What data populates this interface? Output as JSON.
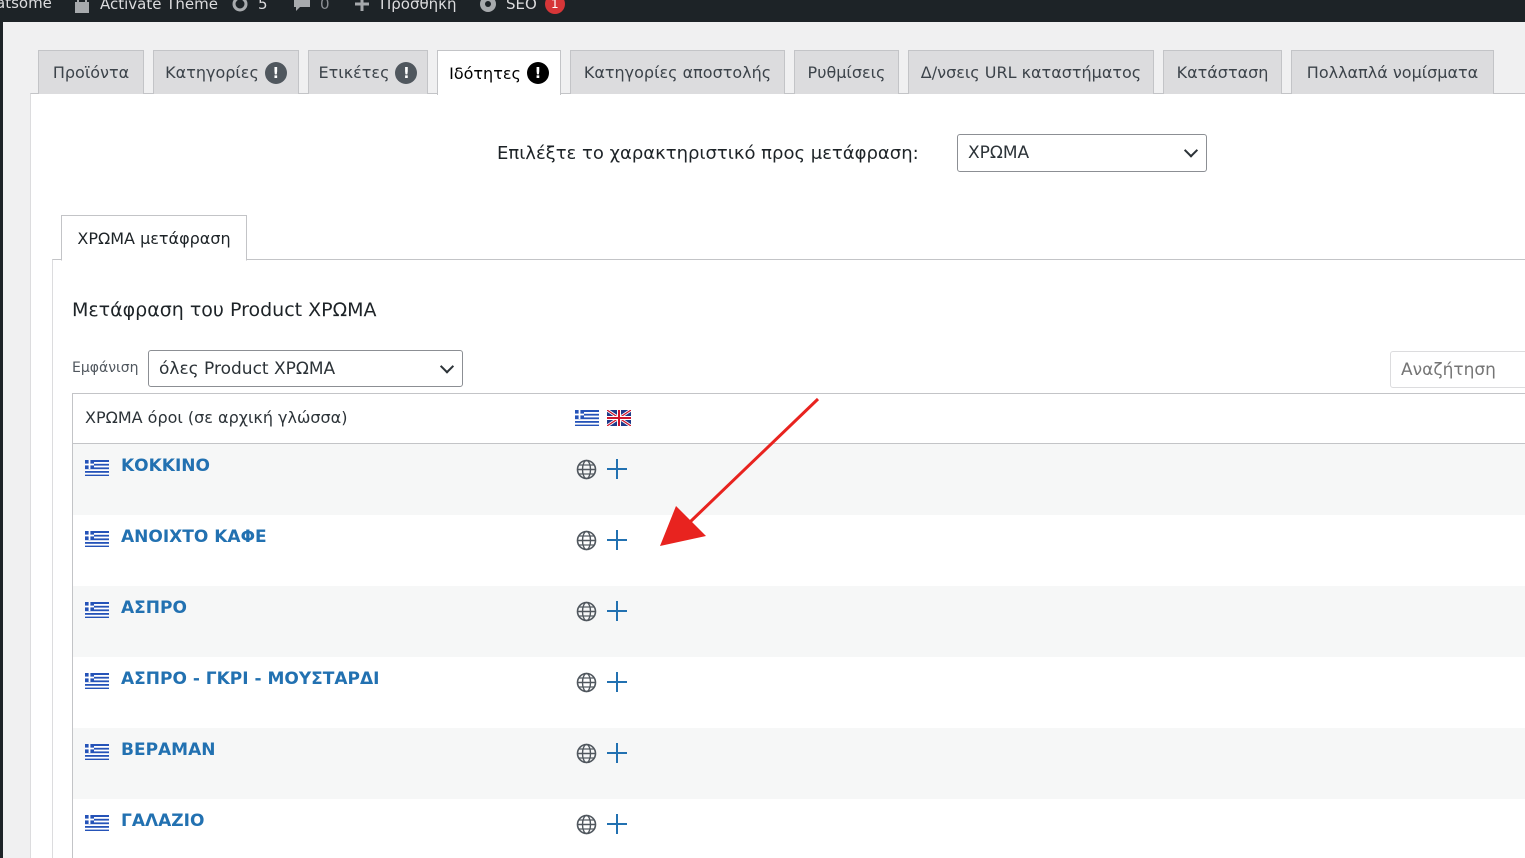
{
  "admin_bar": {
    "site_name": "atsome",
    "activate_theme": "Activate Theme",
    "updates_count": "5",
    "comments_count": "0",
    "add_new": "Προσθήκη",
    "seo": "SEO",
    "seo_count": "1"
  },
  "tabs": [
    {
      "label": "Προϊόντα",
      "alert": false,
      "active": false
    },
    {
      "label": "Κατηγορίες",
      "alert": true,
      "active": false
    },
    {
      "label": "Ετικέτες",
      "alert": true,
      "active": false
    },
    {
      "label": "Ιδότητες",
      "alert": true,
      "active": true
    },
    {
      "label": "Κατηγορίες αποστολής",
      "alert": false,
      "active": false
    },
    {
      "label": "Ρυθμίσεις",
      "alert": false,
      "active": false
    },
    {
      "label": "Δ/νσεις URL καταστήματος",
      "alert": false,
      "active": false
    },
    {
      "label": "Κατάσταση",
      "alert": false,
      "active": false
    },
    {
      "label": "Πολλαπλά νομίσματα",
      "alert": false,
      "active": false
    }
  ],
  "alert_symbol": "!",
  "attribute_picker": {
    "label": "Επιλέξτε το χαρακτηριστικό προς μετάφραση:",
    "selected": "ΧΡΩΜΑ"
  },
  "inner_tab": "ΧΡΩΜΑ μετάφραση",
  "section_title": "Μετάφραση του Product ΧΡΩΜΑ",
  "filter": {
    "label": "Εμφάνιση",
    "selected": "όλες Product ΧΡΩΜΑ"
  },
  "search": {
    "placeholder": "Αναζήτηση"
  },
  "table": {
    "header": "ΧΡΩΜΑ όροι (σε αρχική γλώσσα)",
    "language_flags": [
      "greek-flag-icon",
      "uk-flag-icon"
    ],
    "rows": [
      {
        "term": "ΚΟΚΚΙΝΟ"
      },
      {
        "term": "ΑΝΟΙΧΤΟ ΚΑΦΕ"
      },
      {
        "term": "ΑΣΠΡΟ"
      },
      {
        "term": "ΑΣΠΡΟ - ΓΚΡΙ - ΜΟΥΣΤΑΡΔΙ"
      },
      {
        "term": "ΒΕΡΑΜΑΝ"
      },
      {
        "term": "ΓΑΛΑΖΙΟ"
      }
    ]
  },
  "colors": {
    "link": "#2271b1",
    "alert_active": "#000000",
    "annotation_arrow": "#e8231f"
  }
}
